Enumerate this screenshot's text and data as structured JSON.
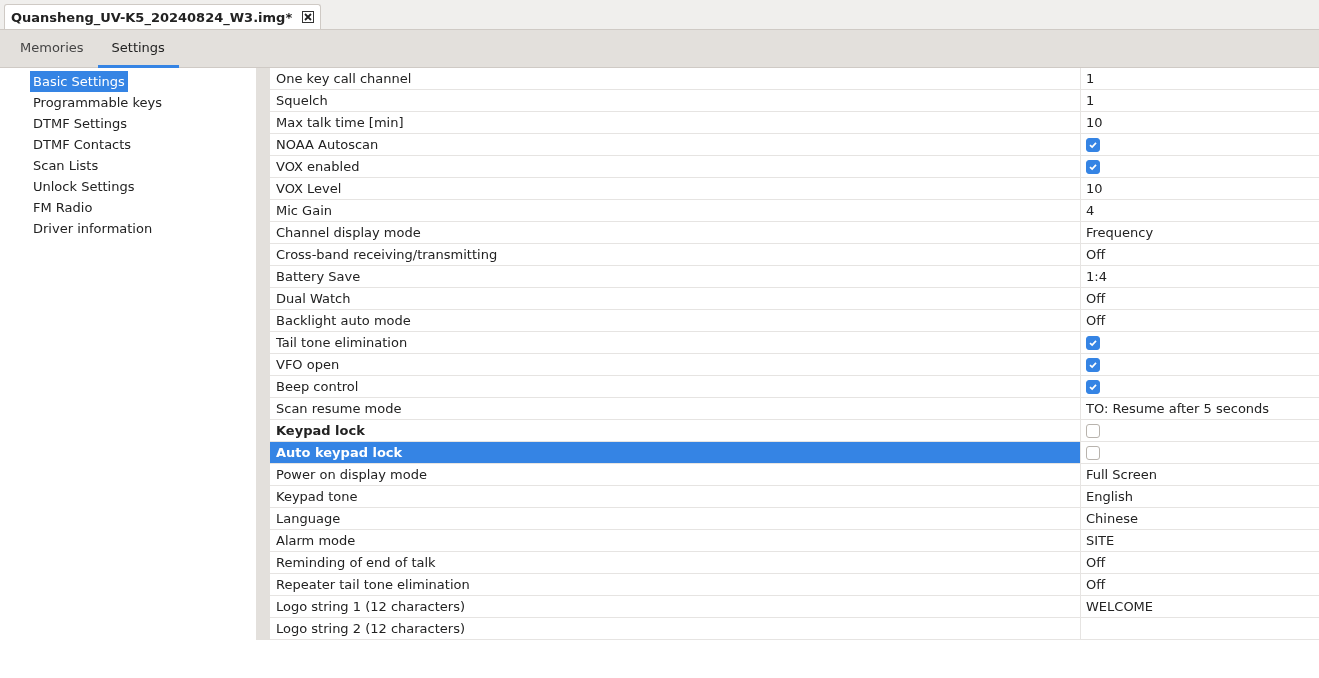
{
  "file_tab": {
    "title": "Quansheng_UV-K5_20240824_W3.img*"
  },
  "tabs": [
    {
      "label": "Memories",
      "selected": false
    },
    {
      "label": "Settings",
      "selected": true
    }
  ],
  "sidebar": {
    "items": [
      {
        "label": "Basic Settings",
        "selected": true
      },
      {
        "label": "Programmable keys",
        "selected": false
      },
      {
        "label": "DTMF Settings",
        "selected": false
      },
      {
        "label": "DTMF Contacts",
        "selected": false
      },
      {
        "label": "Scan Lists",
        "selected": false
      },
      {
        "label": "Unlock Settings",
        "selected": false
      },
      {
        "label": "FM Radio",
        "selected": false
      },
      {
        "label": "Driver information",
        "selected": false
      }
    ]
  },
  "settings": [
    {
      "name": "One key call channel",
      "kind": "text",
      "value": "1",
      "changed": false,
      "selected": false
    },
    {
      "name": "Squelch",
      "kind": "text",
      "value": "1",
      "changed": false,
      "selected": false
    },
    {
      "name": "Max talk time [min]",
      "kind": "text",
      "value": "10",
      "changed": false,
      "selected": false
    },
    {
      "name": "NOAA Autoscan",
      "kind": "checkbox",
      "checked": true,
      "changed": false,
      "selected": false
    },
    {
      "name": "VOX enabled",
      "kind": "checkbox",
      "checked": true,
      "changed": false,
      "selected": false
    },
    {
      "name": "VOX Level",
      "kind": "text",
      "value": "10",
      "changed": false,
      "selected": false
    },
    {
      "name": "Mic Gain",
      "kind": "text",
      "value": "4",
      "changed": false,
      "selected": false
    },
    {
      "name": "Channel display mode",
      "kind": "text",
      "value": "Frequency",
      "changed": false,
      "selected": false
    },
    {
      "name": "Cross-band receiving/transmitting",
      "kind": "text",
      "value": "Off",
      "changed": false,
      "selected": false
    },
    {
      "name": "Battery Save",
      "kind": "text",
      "value": "1:4",
      "changed": false,
      "selected": false
    },
    {
      "name": "Dual Watch",
      "kind": "text",
      "value": "Off",
      "changed": false,
      "selected": false
    },
    {
      "name": "Backlight auto mode",
      "kind": "text",
      "value": "Off",
      "changed": false,
      "selected": false
    },
    {
      "name": "Tail tone elimination",
      "kind": "checkbox",
      "checked": true,
      "changed": false,
      "selected": false
    },
    {
      "name": "VFO open",
      "kind": "checkbox",
      "checked": true,
      "changed": false,
      "selected": false
    },
    {
      "name": "Beep control",
      "kind": "checkbox",
      "checked": true,
      "changed": false,
      "selected": false
    },
    {
      "name": "Scan resume mode",
      "kind": "text",
      "value": "TO: Resume after 5 seconds",
      "changed": false,
      "selected": false
    },
    {
      "name": "Keypad lock",
      "kind": "checkbox",
      "checked": false,
      "changed": true,
      "selected": false
    },
    {
      "name": "Auto keypad lock",
      "kind": "checkbox",
      "checked": false,
      "changed": true,
      "selected": true
    },
    {
      "name": "Power on display mode",
      "kind": "text",
      "value": "Full Screen",
      "changed": false,
      "selected": false
    },
    {
      "name": "Keypad tone",
      "kind": "text",
      "value": "English",
      "changed": false,
      "selected": false
    },
    {
      "name": "Language",
      "kind": "text",
      "value": "Chinese",
      "changed": false,
      "selected": false
    },
    {
      "name": "Alarm mode",
      "kind": "text",
      "value": "SITE",
      "changed": false,
      "selected": false
    },
    {
      "name": "Reminding of end of talk",
      "kind": "text",
      "value": "Off",
      "changed": false,
      "selected": false
    },
    {
      "name": "Repeater tail tone elimination",
      "kind": "text",
      "value": "Off",
      "changed": false,
      "selected": false
    },
    {
      "name": "Logo string 1 (12 characters)",
      "kind": "text",
      "value": "WELCOME",
      "changed": false,
      "selected": false
    },
    {
      "name": "Logo string 2 (12 characters)",
      "kind": "text",
      "changed": false,
      "selected": false
    }
  ]
}
